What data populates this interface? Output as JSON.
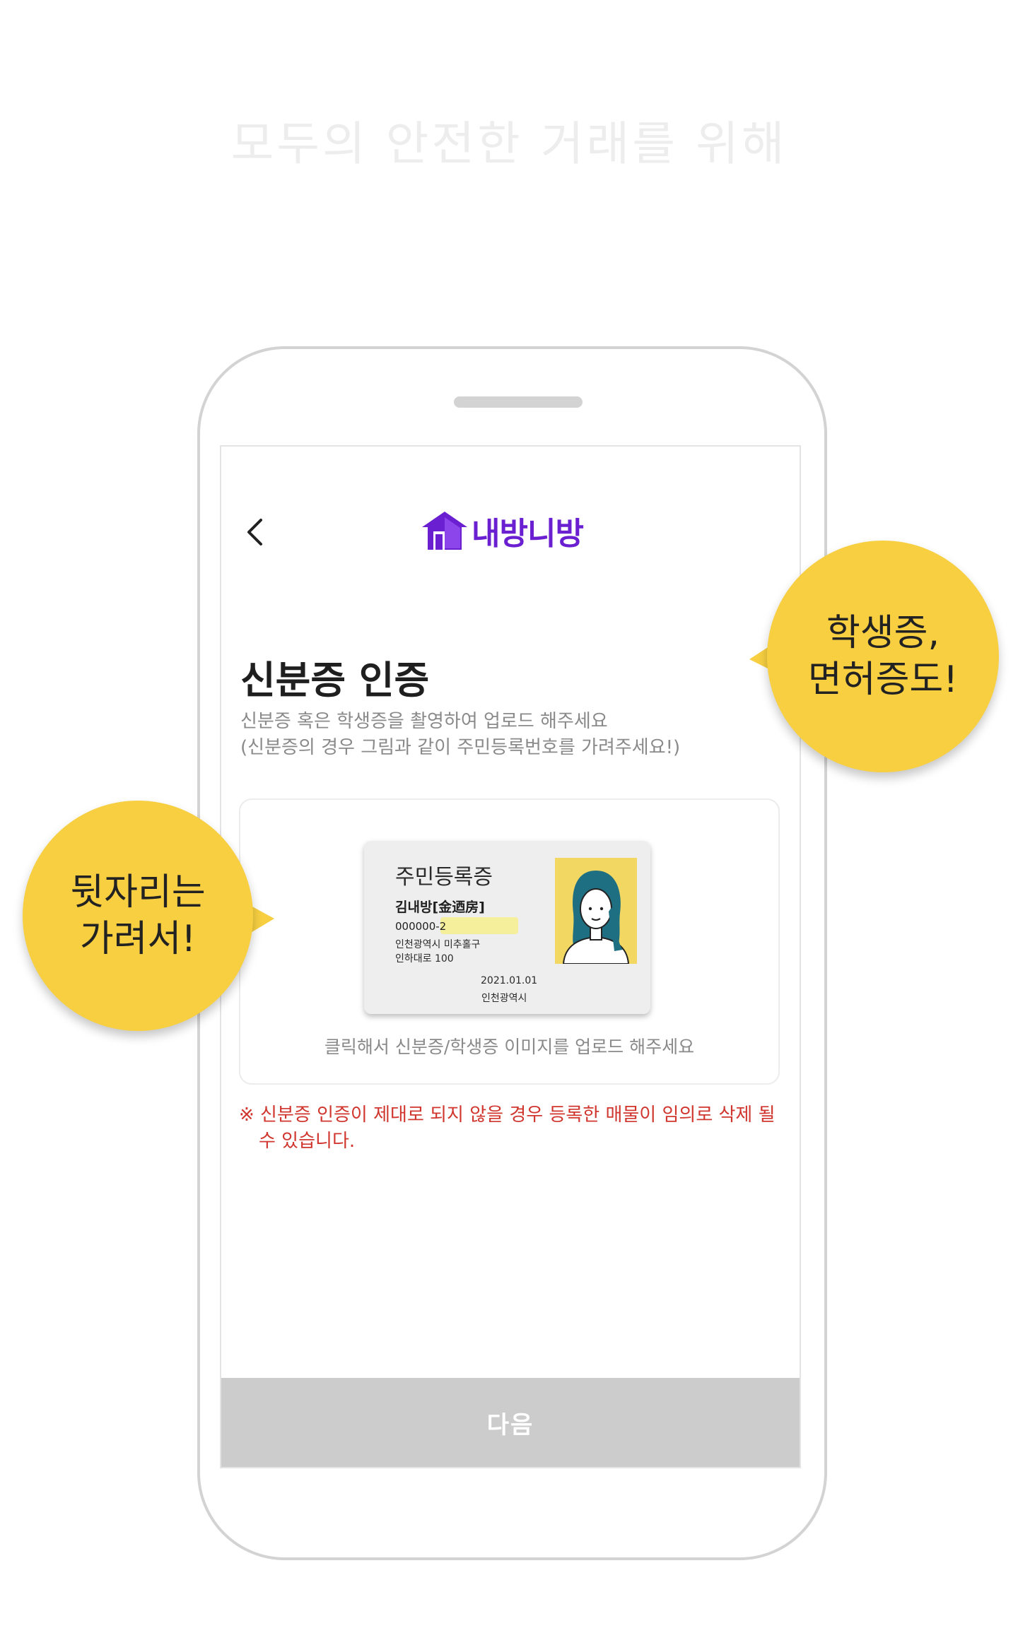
{
  "headline": "모두의 안전한 거래를 위해",
  "header": {
    "logo_text": "내방니방"
  },
  "page": {
    "title": "신분증 인증",
    "desc_line1": "신분증 혹은 학생증을 촬영하여 업로드 해주세요",
    "desc_line2": "(신분증의 경우 그림과 같이 주민등록번호를 가려주세요!)"
  },
  "id_card": {
    "title": "주민등록증",
    "name": "김내방[金迺房]",
    "number": "000000-2",
    "address_line1": "인천광역시 미추홀구",
    "address_line2": "인하대로 100",
    "date": "2021.01.01",
    "issuer": "인천광역시"
  },
  "upload_hint": "클릭해서 신분증/학생증 이미지를 업로드 해주세요",
  "warning": "※ 신분증 인증이 제대로 되지 않을 경우 등록한 매물이 임의로 삭제 될 수 있습니다.",
  "next_button": "다음",
  "bubbles": {
    "right_line1": "학생증,",
    "right_line2": "면허증도!",
    "left_line1": "뒷자리는",
    "left_line2": "가려서!"
  },
  "colors": {
    "brand": "#6a1fd0",
    "bubble": "#f7cf41",
    "warning": "#d0352e",
    "button_disabled": "#cccccc"
  },
  "icons": [
    "back-arrow-icon",
    "house-logo-icon"
  ]
}
